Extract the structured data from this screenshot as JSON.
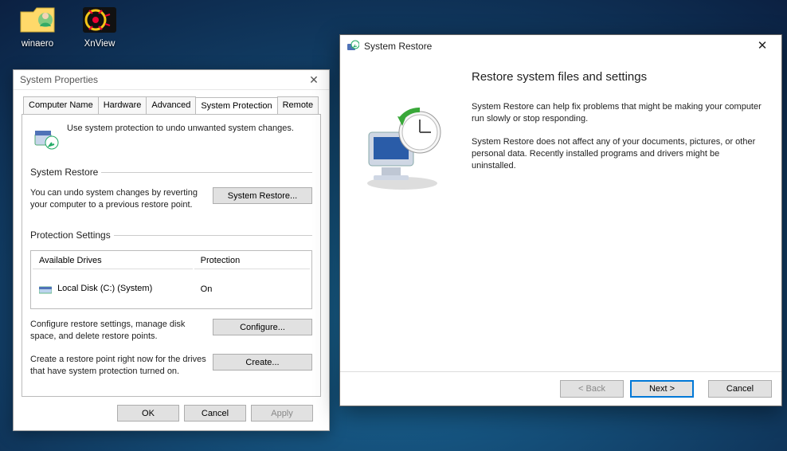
{
  "desktop": {
    "icon1_label": "winaero",
    "icon2_label": "XnView"
  },
  "sysprops": {
    "title": "System Properties",
    "tabs": {
      "computer_name": "Computer Name",
      "hardware": "Hardware",
      "advanced": "Advanced",
      "system_protection": "System Protection",
      "remote": "Remote"
    },
    "active_tab": "System Protection",
    "intro": "Use system protection to undo unwanted system changes.",
    "restore_section_title": "System Restore",
    "restore_desc": "You can undo system changes by reverting your computer to a previous restore point.",
    "restore_button": "System Restore...",
    "protection_section_title": "Protection Settings",
    "drives_header_drive": "Available Drives",
    "drives_header_protection": "Protection",
    "drives": [
      {
        "name": "Local Disk (C:) (System)",
        "protection": "On"
      }
    ],
    "configure_desc": "Configure restore settings, manage disk space, and delete restore points.",
    "configure_button": "Configure...",
    "create_desc": "Create a restore point right now for the drives that have system protection turned on.",
    "create_button": "Create...",
    "ok": "OK",
    "cancel": "Cancel",
    "apply": "Apply"
  },
  "restorewiz": {
    "title": "System Restore",
    "heading": "Restore system files and settings",
    "para1": "System Restore can help fix problems that might be making your computer run slowly or stop responding.",
    "para2": "System Restore does not affect any of your documents, pictures, or other personal data. Recently installed programs and drivers might be uninstalled.",
    "back": "< Back",
    "next": "Next >",
    "cancel": "Cancel"
  }
}
